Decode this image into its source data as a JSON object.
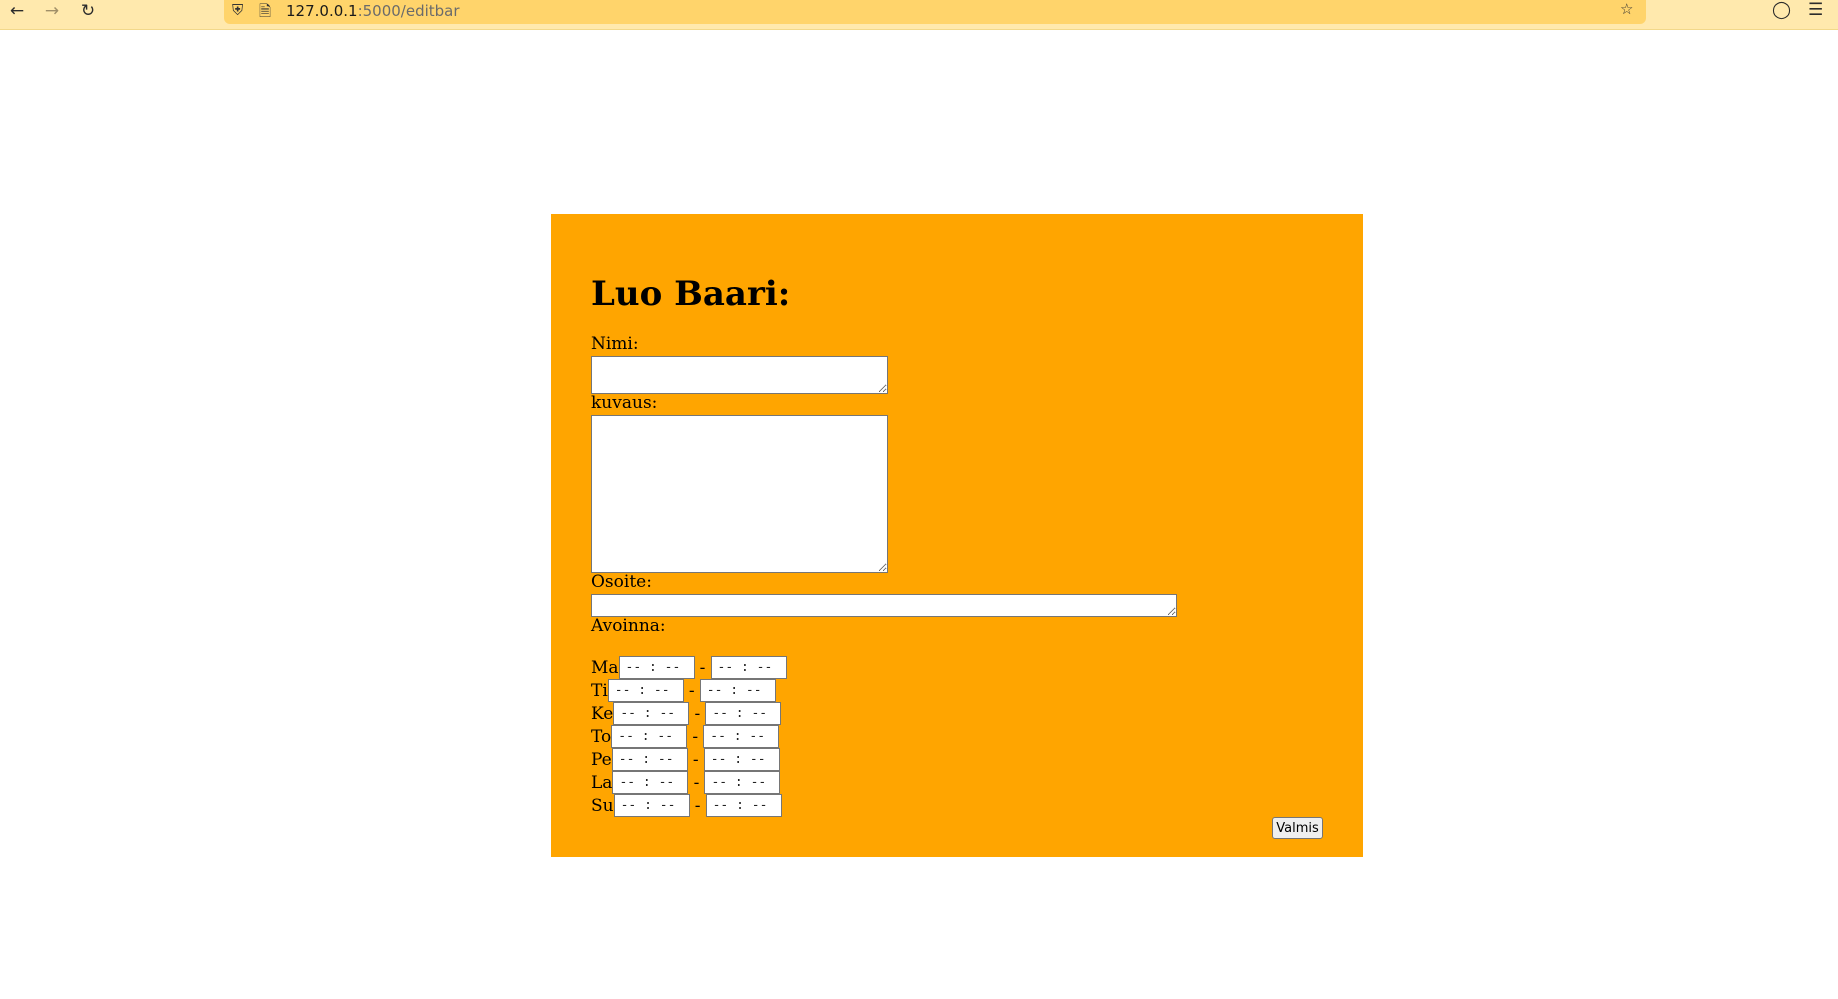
{
  "browser": {
    "url_host": "127.0.0.1",
    "url_path": ":5000/editbar",
    "icons": [
      "back-icon",
      "forward-icon",
      "reload-icon",
      "shield-icon",
      "page-icon",
      "bookmark-star-icon",
      "pocket-icon",
      "menu-icon"
    ]
  },
  "form": {
    "title": "Luo Baari:",
    "name_label": "Nimi:",
    "description_label": "kuvaus:",
    "address_label": "Osoite:",
    "open_label": "Avoinna:",
    "hours": [
      {
        "day": "Ma",
        "open": "-- : --",
        "close": "-- : --"
      },
      {
        "day": "Ti",
        "open": "-- : --",
        "close": "-- : --"
      },
      {
        "day": "Ke",
        "open": "-- : --",
        "close": "-- : --"
      },
      {
        "day": "To",
        "open": "-- : --",
        "close": "-- : --"
      },
      {
        "day": "Pe",
        "open": "-- : --",
        "close": "-- : --"
      },
      {
        "day": "La",
        "open": "-- : --",
        "close": "-- : --"
      },
      {
        "day": "Su",
        "open": "-- : --",
        "close": "-- : --"
      }
    ],
    "separator": "-",
    "submit_label": "Valmis"
  },
  "colors": {
    "card_background": "#ffa500",
    "toolbar_background": "#ffe9ad",
    "urlbar_background": "#ffd46b"
  }
}
